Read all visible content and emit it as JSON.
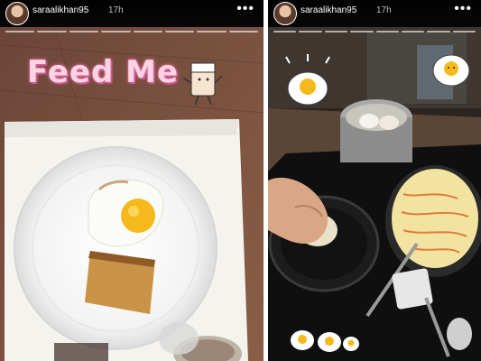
{
  "stories": [
    {
      "username": "saraalikhan95",
      "time": "17h",
      "more_icon": "more-dots-icon",
      "sticker_text": "Feed Me"
    },
    {
      "username": "saraalikhan95",
      "time": "17h",
      "more_icon": "more-dots-icon"
    }
  ],
  "colors": {
    "sticker_pink": "#fbd4e4",
    "sticker_outline": "#e36a9f",
    "yolk": "#f5b91c"
  }
}
